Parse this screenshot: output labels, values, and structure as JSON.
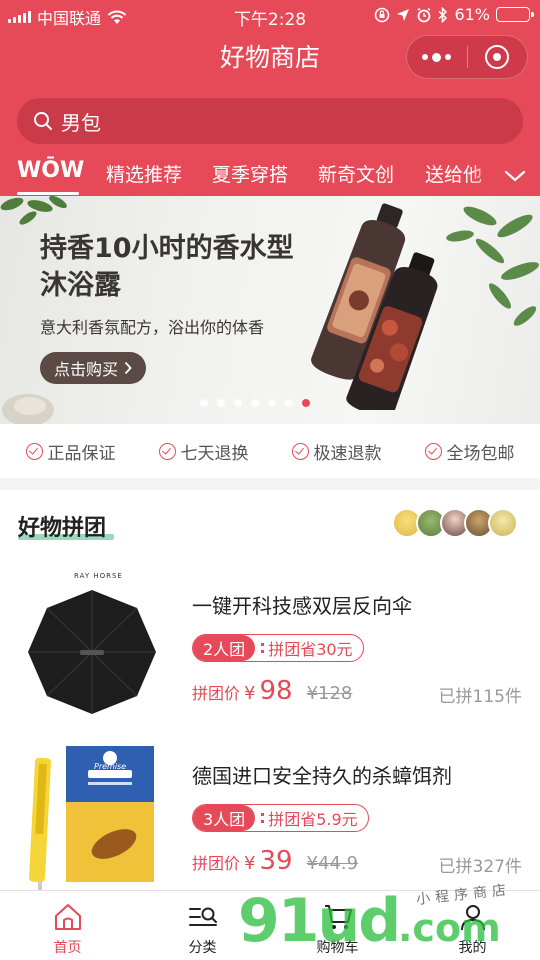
{
  "status_bar": {
    "carrier": "中国联通",
    "time": "下午2:28",
    "battery_percent": "61%",
    "battery_level": 0.61
  },
  "nav": {
    "title": "好物商店"
  },
  "search": {
    "text": "男包"
  },
  "tabs": [
    {
      "label": "WŌW",
      "active": true
    },
    {
      "label": "精选推荐"
    },
    {
      "label": "夏季穿搭"
    },
    {
      "label": "新奇文创"
    },
    {
      "label": "送给他"
    }
  ],
  "banner": {
    "title": "持香10小时的香水型沐浴露",
    "subtitle": "意大利香氛配方，浴出你的体香",
    "button": "点击购买",
    "slide_count": 7,
    "active_slide": 6
  },
  "guarantees": [
    "正品保证",
    "七天退换",
    "极速退款",
    "全场包邮"
  ],
  "group_buy": {
    "title": "好物拼团",
    "products": [
      {
        "image_brand": "RAY HORSE",
        "name": "一键开科技感双层反向伞",
        "group_size": "2人团",
        "saving": "拼团省30元",
        "price_label": "拼团价",
        "currency": "¥",
        "price": "98",
        "original_price": "¥128",
        "sold": "已拼115件"
      },
      {
        "image_brand": "Premise",
        "name": "德国进口安全持久的杀蟑饵剂",
        "group_size": "3人团",
        "saving": "拼团省5.9元",
        "price_label": "拼团价",
        "currency": "¥",
        "price": "39",
        "original_price": "¥44.9",
        "sold": "已拼327件"
      }
    ]
  },
  "tabbar": [
    {
      "label": "首页",
      "icon": "home-icon",
      "active": true
    },
    {
      "label": "分类",
      "icon": "category-icon"
    },
    {
      "label": "购物车",
      "icon": "cart-icon"
    },
    {
      "label": "我的",
      "icon": "profile-icon"
    }
  ],
  "watermark": {
    "text1": "91ud",
    "text2": ".com",
    "note": "小程序商店"
  },
  "colors": {
    "accent": "#e64a58",
    "highlight": "#6fc9a3"
  }
}
